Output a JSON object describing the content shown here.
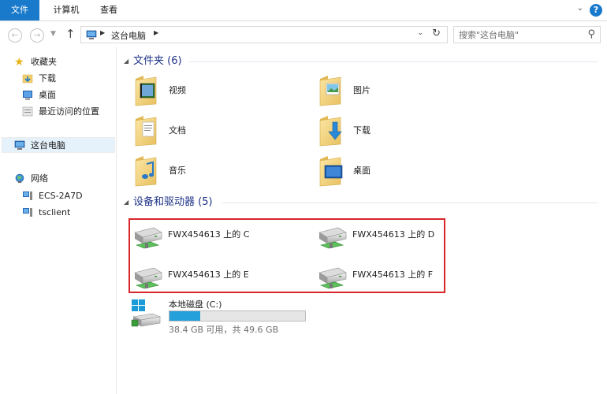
{
  "ribbon": {
    "tabs": [
      {
        "label": "文件",
        "active": true
      },
      {
        "label": "计算机",
        "active": false
      },
      {
        "label": "查看",
        "active": false
      }
    ],
    "help_label": "?",
    "accent_color": "#1979ca"
  },
  "address_bar": {
    "breadcrumb": "这台电脑",
    "search_placeholder": "搜索\"这台电脑\""
  },
  "nav_pane": {
    "favorites": {
      "label": "收藏夹",
      "items": [
        "下载",
        "桌面",
        "最近访问的位置"
      ]
    },
    "this_pc": {
      "label": "这台电脑",
      "selected": true
    },
    "network": {
      "label": "网络",
      "items": [
        "ECS-2A7D",
        "tsclient"
      ]
    }
  },
  "content": {
    "folders_group": {
      "title": "文件夹 (6)",
      "items": [
        {
          "name": "视频",
          "icon": "videos-folder-icon"
        },
        {
          "name": "图片",
          "icon": "pictures-folder-icon"
        },
        {
          "name": "文档",
          "icon": "documents-folder-icon"
        },
        {
          "name": "下载",
          "icon": "downloads-folder-icon"
        },
        {
          "name": "音乐",
          "icon": "music-folder-icon"
        },
        {
          "name": "桌面",
          "icon": "desktop-folder-icon"
        }
      ]
    },
    "drives_group": {
      "title": "设备和驱动器 (5)",
      "network_drives": [
        {
          "name": "FWX454613 上的 C"
        },
        {
          "name": "FWX454613 上的 D"
        },
        {
          "name": "FWX454613 上的 E"
        },
        {
          "name": "FWX454613 上的 F"
        }
      ],
      "local_disk": {
        "name": "本地磁盘 (C:)",
        "free_text": "38.4 GB 可用，共 49.6 GB",
        "used_fraction": 0.226
      }
    }
  }
}
